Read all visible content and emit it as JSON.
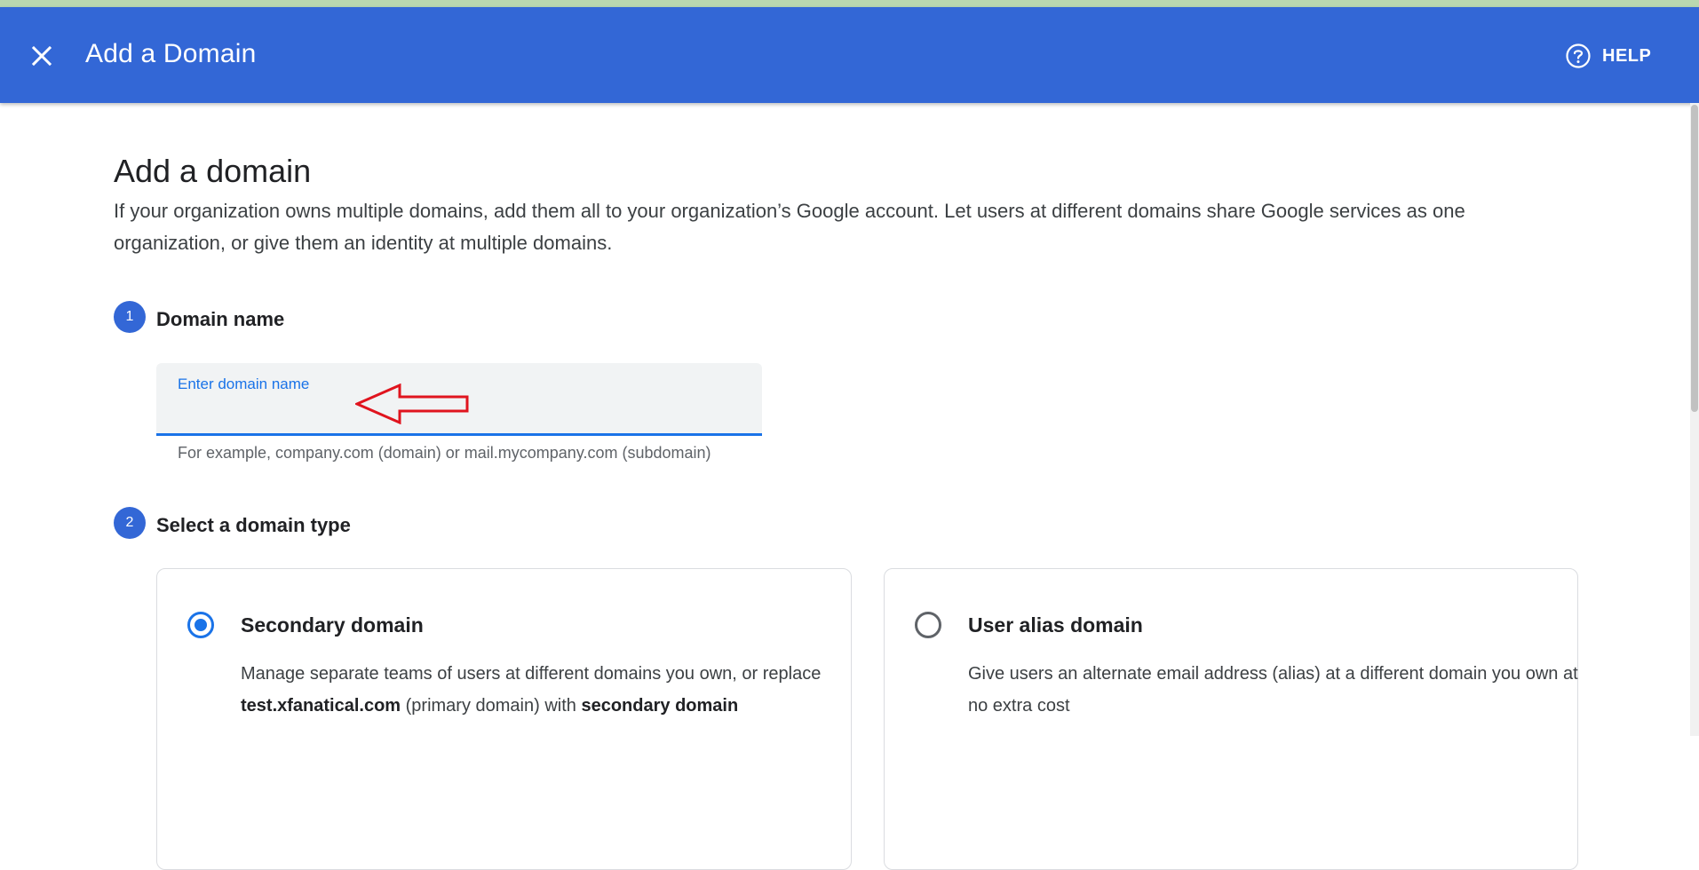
{
  "app_bar": {
    "title": "Add a Domain",
    "help_label": "HELP",
    "close_icon": "close-icon",
    "help_icon": "help-circle-icon",
    "background": "#3367d6"
  },
  "page": {
    "heading": "Add a domain",
    "description": "If your organization owns multiple domains, add them all to your organization’s Google account. Let users at different domains share Google services as one organization, or give them an identity at multiple domains."
  },
  "step1": {
    "number": "1",
    "title": "Domain name",
    "input_label": "Enter domain name",
    "input_value": "",
    "hint": "For example, company.com (domain) or mail.mycompany.com (subdomain)"
  },
  "step2": {
    "number": "2",
    "title": "Select a domain type",
    "options": [
      {
        "title": "Secondary domain",
        "selected": true,
        "desc_part1": "Manage separate teams of users at different domains you own, or replace ",
        "desc_bold1": "test.xfanatical.com",
        "desc_part2": " (primary domain) with ",
        "desc_bold2": "secondary domain"
      },
      {
        "title": "User alias domain",
        "selected": false,
        "desc": "Give users an alternate email address (alias) at a different domain you own at no extra cost"
      }
    ]
  },
  "colors": {
    "accent": "#1a73e8",
    "annotation_arrow": "#e0141e"
  }
}
